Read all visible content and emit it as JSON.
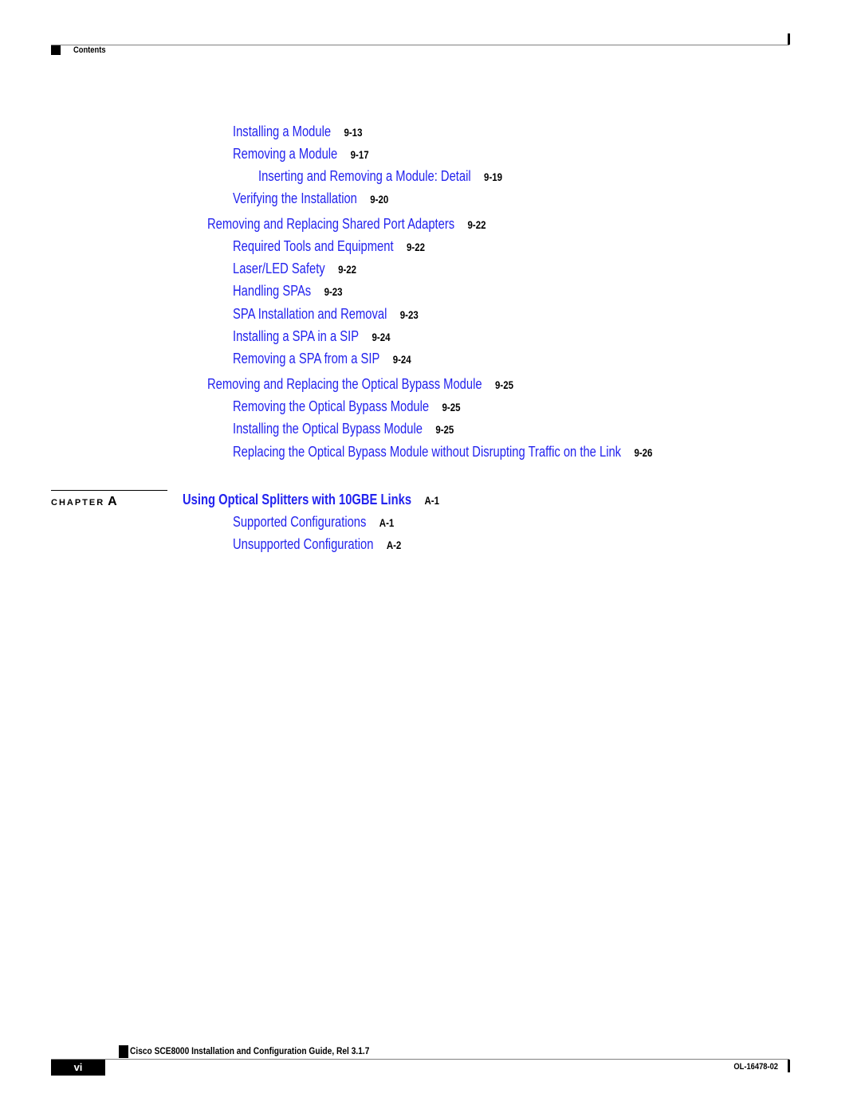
{
  "header": {
    "section_label": "Contents"
  },
  "toc": [
    {
      "title": "Installing a Module",
      "page": "9-13",
      "level": 2
    },
    {
      "title": "Removing a Module",
      "page": "9-17",
      "level": 2
    },
    {
      "title": "Inserting and Removing a Module: Detail",
      "page": "9-19",
      "level": 3
    },
    {
      "title": "Verifying the Installation",
      "page": "9-20",
      "level": 2
    },
    {
      "title": "Removing and Replacing Shared Port Adapters",
      "page": "9-22",
      "level": 1
    },
    {
      "title": "Required Tools and Equipment",
      "page": "9-22",
      "level": 2
    },
    {
      "title": "Laser/LED Safety",
      "page": "9-22",
      "level": 2
    },
    {
      "title": "Handling SPAs",
      "page": "9-23",
      "level": 2
    },
    {
      "title": "SPA Installation and Removal",
      "page": "9-23",
      "level": 2
    },
    {
      "title": "Installing a SPA in a SIP",
      "page": "9-24",
      "level": 2
    },
    {
      "title": "Removing a SPA from a SIP",
      "page": "9-24",
      "level": 2
    },
    {
      "title": "Removing and Replacing the Optical Bypass Module",
      "page": "9-25",
      "level": 1
    },
    {
      "title": "Removing the Optical Bypass Module",
      "page": "9-25",
      "level": 2
    },
    {
      "title": "Installing the Optical Bypass Module",
      "page": "9-25",
      "level": 2
    },
    {
      "title": "Replacing the Optical Bypass Module without Disrupting Traffic on the Link",
      "page": "9-26",
      "level": 2
    }
  ],
  "chapter": {
    "label": "CHAPTER",
    "letter": "A",
    "title": "Using Optical Splitters with 10GBE Links",
    "page": "A-1",
    "entries": [
      {
        "title": "Supported Configurations",
        "page": "A-1"
      },
      {
        "title": "Unsupported Configuration",
        "page": "A-2"
      }
    ]
  },
  "footer": {
    "book_title": "Cisco SCE8000 Installation and Configuration Guide, Rel 3.1.7",
    "page_number": "vi",
    "doc_number": "OL-16478-02"
  },
  "colors": {
    "link": "#2323ee",
    "text": "#000000"
  }
}
